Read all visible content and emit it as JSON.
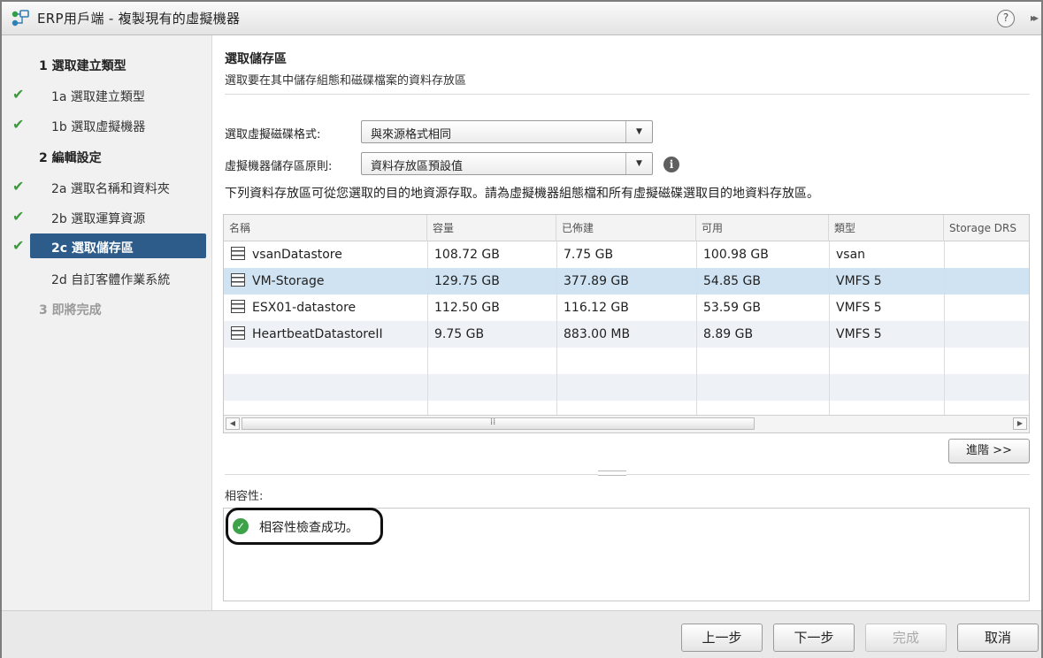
{
  "window": {
    "title": "ERP用戶端 - 複製現有的虛擬機器",
    "help_label": "?",
    "expand_label": "▸▸"
  },
  "sidebar": {
    "steps": [
      {
        "label": "1  選取建立類型",
        "kind": "group",
        "checked": false
      },
      {
        "label": "1a  選取建立類型",
        "kind": "sub",
        "checked": true
      },
      {
        "label": "1b  選取虛擬機器",
        "kind": "sub",
        "checked": true
      },
      {
        "label": "2  編輯設定",
        "kind": "group",
        "checked": false
      },
      {
        "label": "2a  選取名稱和資料夾",
        "kind": "sub",
        "checked": true
      },
      {
        "label": "2b  選取運算資源",
        "kind": "sub",
        "checked": true
      },
      {
        "label": "2c  選取儲存區",
        "kind": "sub",
        "checked": true,
        "active": true
      },
      {
        "label": "2d  自訂客體作業系統",
        "kind": "sub",
        "checked": false
      },
      {
        "label": "3  即將完成",
        "kind": "group",
        "checked": false,
        "disabled": true
      }
    ],
    "check_glyph": "✔"
  },
  "main": {
    "title": "選取儲存區",
    "subtitle": "選取要在其中儲存組態和磁碟檔案的資料存放區",
    "disk_format": {
      "label": "選取虛擬磁碟格式:",
      "value": "與來源格式相同"
    },
    "storage_policy": {
      "label": "虛擬機器儲存區原則:",
      "value": "資料存放區預設值"
    },
    "description": "下列資料存放區可從您選取的目的地資源存取。請為虛擬機器組態檔和所有虛擬磁碟選取目的地資料存放區。",
    "table": {
      "columns": [
        "名稱",
        "容量",
        "已佈建",
        "可用",
        "類型",
        "Storage DRS"
      ],
      "rows": [
        {
          "name": "vsanDatastore",
          "capacity": "108.72 GB",
          "provisioned": "7.75 GB",
          "free": "100.98 GB",
          "type": "vsan",
          "drs": "",
          "selected": false
        },
        {
          "name": "VM-Storage",
          "capacity": "129.75 GB",
          "provisioned": "377.89 GB",
          "free": "54.85 GB",
          "type": "VMFS 5",
          "drs": "",
          "selected": true
        },
        {
          "name": "ESX01-datastore",
          "capacity": "112.50 GB",
          "provisioned": "116.12 GB",
          "free": "53.59 GB",
          "type": "VMFS 5",
          "drs": "",
          "selected": false
        },
        {
          "name": "HeartbeatDatastoreII",
          "capacity": "9.75 GB",
          "provisioned": "883.00 MB",
          "free": "8.89 GB",
          "type": "VMFS 5",
          "drs": "",
          "selected": false
        }
      ]
    },
    "advanced_button": "進階 >>",
    "compat_label": "相容性:",
    "compat_message": "相容性檢查成功。"
  },
  "footer": {
    "back": "上一步",
    "next": "下一步",
    "finish": "完成",
    "cancel": "取消"
  },
  "colors": {
    "active_step": "#2d5c8a",
    "selected_row": "#cfe3f3",
    "check": "#3e9a3e",
    "ok": "#3ea24a"
  },
  "icons": [
    "app-icon",
    "help-icon",
    "expand-icon",
    "check-icon",
    "info-icon",
    "datastore-icon",
    "dropdown-arrow-icon",
    "success-icon"
  ]
}
